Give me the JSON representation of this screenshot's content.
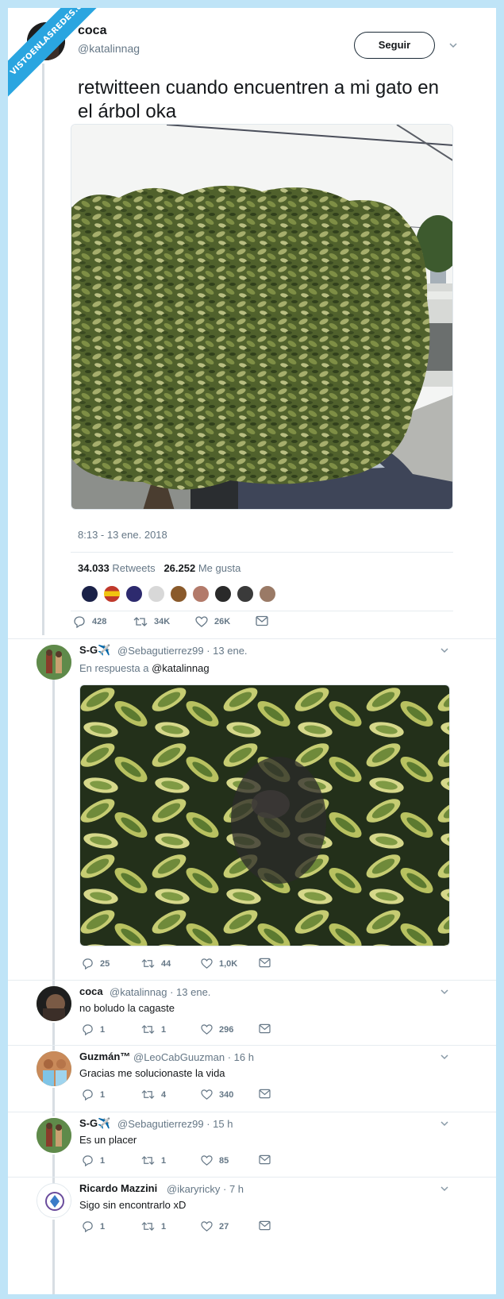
{
  "watermark": "VISTOENLASREDES.com",
  "main_tweet": {
    "name": "coca",
    "handle": "@katalinnag",
    "follow_label": "Seguir",
    "text": "retwitteen cuando encuentren a mi gato en el árbol oka",
    "timestamp": "8:13 - 13 ene. 2018",
    "retweets_count": "34.033",
    "retweets_label": "Retweets",
    "likes_count": "26.252",
    "likes_label": "Me gusta",
    "actions": {
      "replies": "428",
      "retweets": "34K",
      "likes": "26K"
    }
  },
  "replies": [
    {
      "name": "S-G✈️",
      "handle": "@Sebagutierrez99",
      "date": "· 13 ene.",
      "in_reply_prefix": "En respuesta a",
      "in_reply_handle": "@katalinnag",
      "text": "",
      "actions": {
        "replies": "25",
        "retweets": "44",
        "likes": "1,0K"
      }
    },
    {
      "name": "coca",
      "handle": "@katalinnag",
      "date": "· 13 ene.",
      "text": "no boludo la cagaste",
      "actions": {
        "replies": "1",
        "retweets": "1",
        "likes": "296"
      }
    },
    {
      "name": "Guzmán™",
      "handle": "@LeoCabGuuzman",
      "date": "· 16 h",
      "text": "Gracias me solucionaste la vida",
      "actions": {
        "replies": "1",
        "retweets": "4",
        "likes": "340"
      }
    },
    {
      "name": "S-G✈️",
      "handle": "@Sebagutierrez99",
      "date": "· 15 h",
      "text": "Es un placer",
      "actions": {
        "replies": "1",
        "retweets": "1",
        "likes": "85"
      }
    },
    {
      "name": "Ricardo Mazzini",
      "handle": "@ikaryricky",
      "date": "· 7 h",
      "text": "Sigo sin encontrarlo xD",
      "actions": {
        "replies": "1",
        "retweets": "1",
        "likes": "27"
      }
    }
  ],
  "colors": {
    "accent": "#1b95e0",
    "muted": "#657786",
    "background": "#bfe4f7",
    "ribbon": "#2aa5e0"
  },
  "icons": [
    "reply-icon",
    "retweet-icon",
    "like-icon",
    "dm-icon",
    "chevron-down-icon"
  ]
}
